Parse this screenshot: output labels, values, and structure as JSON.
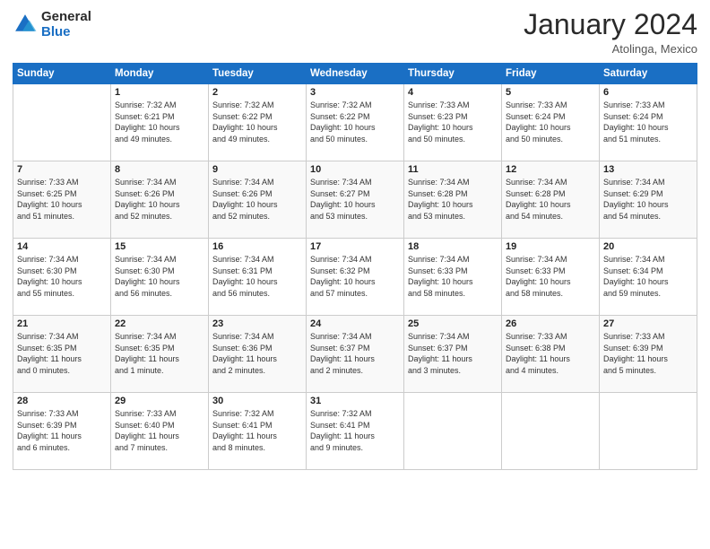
{
  "logo": {
    "line1": "General",
    "line2": "Blue"
  },
  "title": "January 2024",
  "location": "Atolinga, Mexico",
  "days_header": [
    "Sunday",
    "Monday",
    "Tuesday",
    "Wednesday",
    "Thursday",
    "Friday",
    "Saturday"
  ],
  "weeks": [
    [
      {
        "num": "",
        "info": ""
      },
      {
        "num": "1",
        "info": "Sunrise: 7:32 AM\nSunset: 6:21 PM\nDaylight: 10 hours\nand 49 minutes."
      },
      {
        "num": "2",
        "info": "Sunrise: 7:32 AM\nSunset: 6:22 PM\nDaylight: 10 hours\nand 49 minutes."
      },
      {
        "num": "3",
        "info": "Sunrise: 7:32 AM\nSunset: 6:22 PM\nDaylight: 10 hours\nand 50 minutes."
      },
      {
        "num": "4",
        "info": "Sunrise: 7:33 AM\nSunset: 6:23 PM\nDaylight: 10 hours\nand 50 minutes."
      },
      {
        "num": "5",
        "info": "Sunrise: 7:33 AM\nSunset: 6:24 PM\nDaylight: 10 hours\nand 50 minutes."
      },
      {
        "num": "6",
        "info": "Sunrise: 7:33 AM\nSunset: 6:24 PM\nDaylight: 10 hours\nand 51 minutes."
      }
    ],
    [
      {
        "num": "7",
        "info": "Sunrise: 7:33 AM\nSunset: 6:25 PM\nDaylight: 10 hours\nand 51 minutes."
      },
      {
        "num": "8",
        "info": "Sunrise: 7:34 AM\nSunset: 6:26 PM\nDaylight: 10 hours\nand 52 minutes."
      },
      {
        "num": "9",
        "info": "Sunrise: 7:34 AM\nSunset: 6:26 PM\nDaylight: 10 hours\nand 52 minutes."
      },
      {
        "num": "10",
        "info": "Sunrise: 7:34 AM\nSunset: 6:27 PM\nDaylight: 10 hours\nand 53 minutes."
      },
      {
        "num": "11",
        "info": "Sunrise: 7:34 AM\nSunset: 6:28 PM\nDaylight: 10 hours\nand 53 minutes."
      },
      {
        "num": "12",
        "info": "Sunrise: 7:34 AM\nSunset: 6:28 PM\nDaylight: 10 hours\nand 54 minutes."
      },
      {
        "num": "13",
        "info": "Sunrise: 7:34 AM\nSunset: 6:29 PM\nDaylight: 10 hours\nand 54 minutes."
      }
    ],
    [
      {
        "num": "14",
        "info": "Sunrise: 7:34 AM\nSunset: 6:30 PM\nDaylight: 10 hours\nand 55 minutes."
      },
      {
        "num": "15",
        "info": "Sunrise: 7:34 AM\nSunset: 6:30 PM\nDaylight: 10 hours\nand 56 minutes."
      },
      {
        "num": "16",
        "info": "Sunrise: 7:34 AM\nSunset: 6:31 PM\nDaylight: 10 hours\nand 56 minutes."
      },
      {
        "num": "17",
        "info": "Sunrise: 7:34 AM\nSunset: 6:32 PM\nDaylight: 10 hours\nand 57 minutes."
      },
      {
        "num": "18",
        "info": "Sunrise: 7:34 AM\nSunset: 6:33 PM\nDaylight: 10 hours\nand 58 minutes."
      },
      {
        "num": "19",
        "info": "Sunrise: 7:34 AM\nSunset: 6:33 PM\nDaylight: 10 hours\nand 58 minutes."
      },
      {
        "num": "20",
        "info": "Sunrise: 7:34 AM\nSunset: 6:34 PM\nDaylight: 10 hours\nand 59 minutes."
      }
    ],
    [
      {
        "num": "21",
        "info": "Sunrise: 7:34 AM\nSunset: 6:35 PM\nDaylight: 11 hours\nand 0 minutes."
      },
      {
        "num": "22",
        "info": "Sunrise: 7:34 AM\nSunset: 6:35 PM\nDaylight: 11 hours\nand 1 minute."
      },
      {
        "num": "23",
        "info": "Sunrise: 7:34 AM\nSunset: 6:36 PM\nDaylight: 11 hours\nand 2 minutes."
      },
      {
        "num": "24",
        "info": "Sunrise: 7:34 AM\nSunset: 6:37 PM\nDaylight: 11 hours\nand 2 minutes."
      },
      {
        "num": "25",
        "info": "Sunrise: 7:34 AM\nSunset: 6:37 PM\nDaylight: 11 hours\nand 3 minutes."
      },
      {
        "num": "26",
        "info": "Sunrise: 7:33 AM\nSunset: 6:38 PM\nDaylight: 11 hours\nand 4 minutes."
      },
      {
        "num": "27",
        "info": "Sunrise: 7:33 AM\nSunset: 6:39 PM\nDaylight: 11 hours\nand 5 minutes."
      }
    ],
    [
      {
        "num": "28",
        "info": "Sunrise: 7:33 AM\nSunset: 6:39 PM\nDaylight: 11 hours\nand 6 minutes."
      },
      {
        "num": "29",
        "info": "Sunrise: 7:33 AM\nSunset: 6:40 PM\nDaylight: 11 hours\nand 7 minutes."
      },
      {
        "num": "30",
        "info": "Sunrise: 7:32 AM\nSunset: 6:41 PM\nDaylight: 11 hours\nand 8 minutes."
      },
      {
        "num": "31",
        "info": "Sunrise: 7:32 AM\nSunset: 6:41 PM\nDaylight: 11 hours\nand 9 minutes."
      },
      {
        "num": "",
        "info": ""
      },
      {
        "num": "",
        "info": ""
      },
      {
        "num": "",
        "info": ""
      }
    ]
  ]
}
